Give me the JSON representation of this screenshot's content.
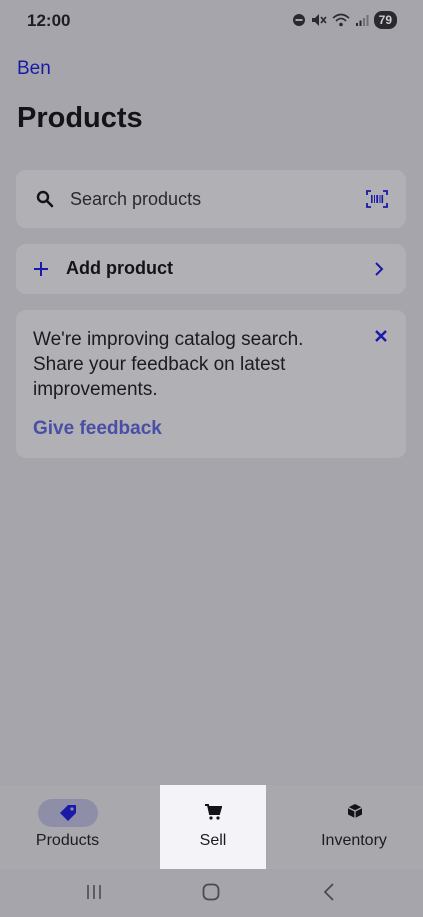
{
  "status_bar": {
    "time": "12:00",
    "battery": "79"
  },
  "header": {
    "user_name": "Ben",
    "title": "Products"
  },
  "search": {
    "placeholder": "Search products"
  },
  "add_product": {
    "label": "Add product"
  },
  "feedback": {
    "message": "We're improving catalog search. Share your feedback on latest improvements.",
    "link_label": "Give feedback"
  },
  "bottom_nav": {
    "items": [
      {
        "label": "Products",
        "icon": "tag-icon",
        "active": true
      },
      {
        "label": "Sell",
        "icon": "cart-icon",
        "active": false
      },
      {
        "label": "Inventory",
        "icon": "box-icon",
        "active": false
      }
    ]
  },
  "colors": {
    "accent": "#1a1aa6",
    "overlay_bg": "#a5a5ab",
    "highlight": "#f4f4f8"
  }
}
